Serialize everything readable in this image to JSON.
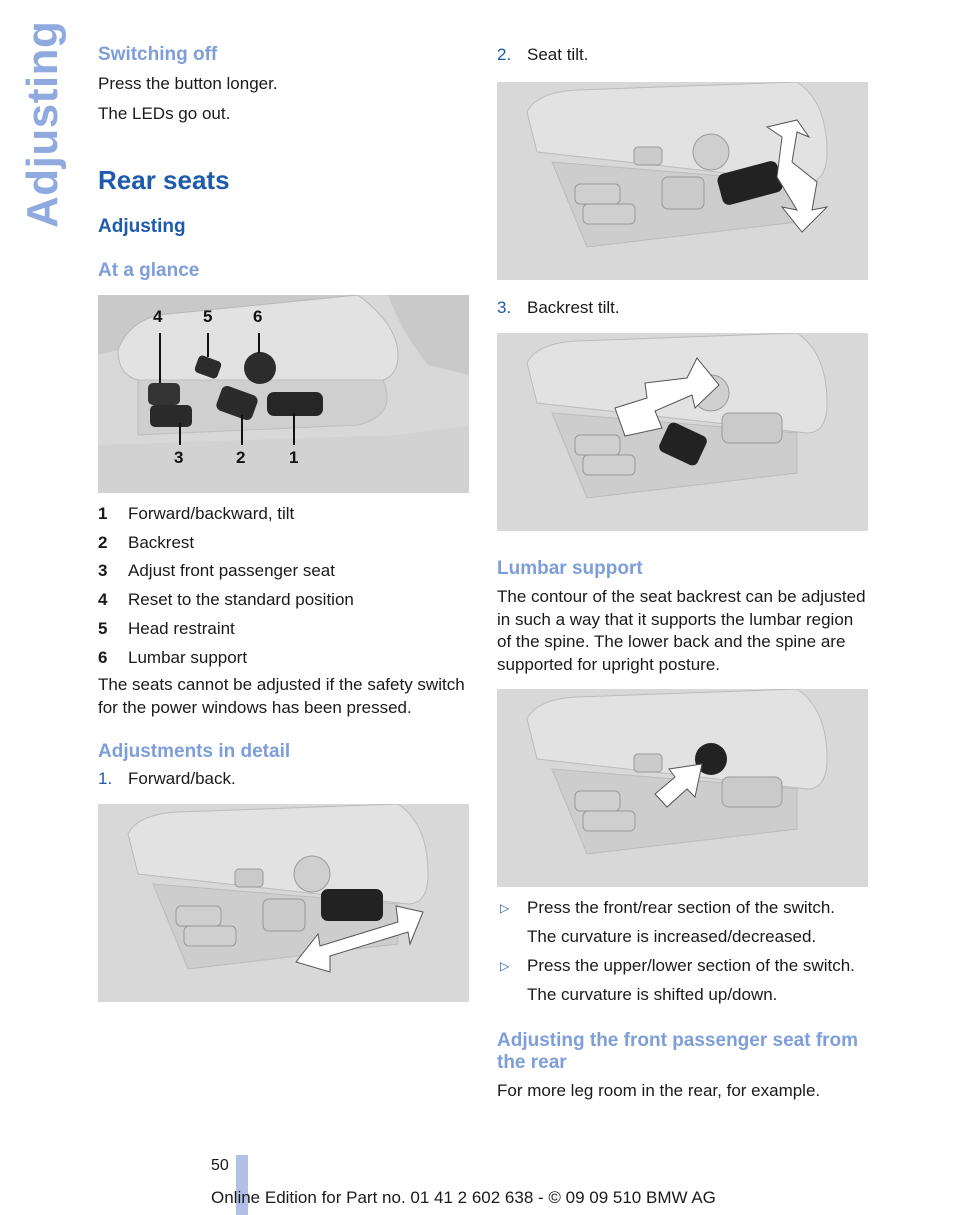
{
  "side_title": "Adjusting",
  "left": {
    "switching_off": {
      "heading": "Switching off",
      "lines": [
        "Press the button longer.",
        "The LEDs go out."
      ]
    },
    "section_title": "Rear seats",
    "subsection_title": "Adjusting",
    "at_a_glance": {
      "heading": "At a glance",
      "figure_callouts": [
        "4",
        "5",
        "6",
        "3",
        "2",
        "1"
      ],
      "legend": [
        {
          "num": "1",
          "label": "Forward/backward, tilt"
        },
        {
          "num": "2",
          "label": "Backrest"
        },
        {
          "num": "3",
          "label": "Adjust front passenger seat"
        },
        {
          "num": "4",
          "label": "Reset to the standard position"
        },
        {
          "num": "5",
          "label": "Head restraint"
        },
        {
          "num": "6",
          "label": "Lumbar support"
        }
      ],
      "note": "The seats cannot be adjusted if the safety switch for the power windows has been pressed."
    },
    "adjustments": {
      "heading": "Adjustments in detail",
      "step1": {
        "num": "1.",
        "label": "Forward/back."
      }
    }
  },
  "right": {
    "step2": {
      "num": "2.",
      "label": "Seat tilt."
    },
    "step3": {
      "num": "3.",
      "label": "Backrest tilt."
    },
    "lumbar": {
      "heading": "Lumbar support",
      "text": "The contour of the seat backrest can be adjusted in such a way that it supports the lumbar region of the spine. The lower back and the spine are supported for upright posture.",
      "bullets": [
        {
          "action": "Press the front/rear section of the switch.",
          "result": "The curvature is increased/decreased."
        },
        {
          "action": "Press the upper/lower section of the switch.",
          "result": "The curvature is shifted up/down."
        }
      ]
    },
    "front_passenger": {
      "heading": "Adjusting the front passenger seat from the rear",
      "text": "For more leg room in the rear, for example."
    }
  },
  "footer": {
    "page_number": "50",
    "edition": "Online Edition for Part no. 01 41 2 602 638 - © 09 09 510 BMW AG"
  },
  "colors": {
    "heading_light": "#7d9ed9",
    "heading_dark": "#1f5bab",
    "side_title": "#8eaadf",
    "footer_bar": "#b2c0e6"
  }
}
